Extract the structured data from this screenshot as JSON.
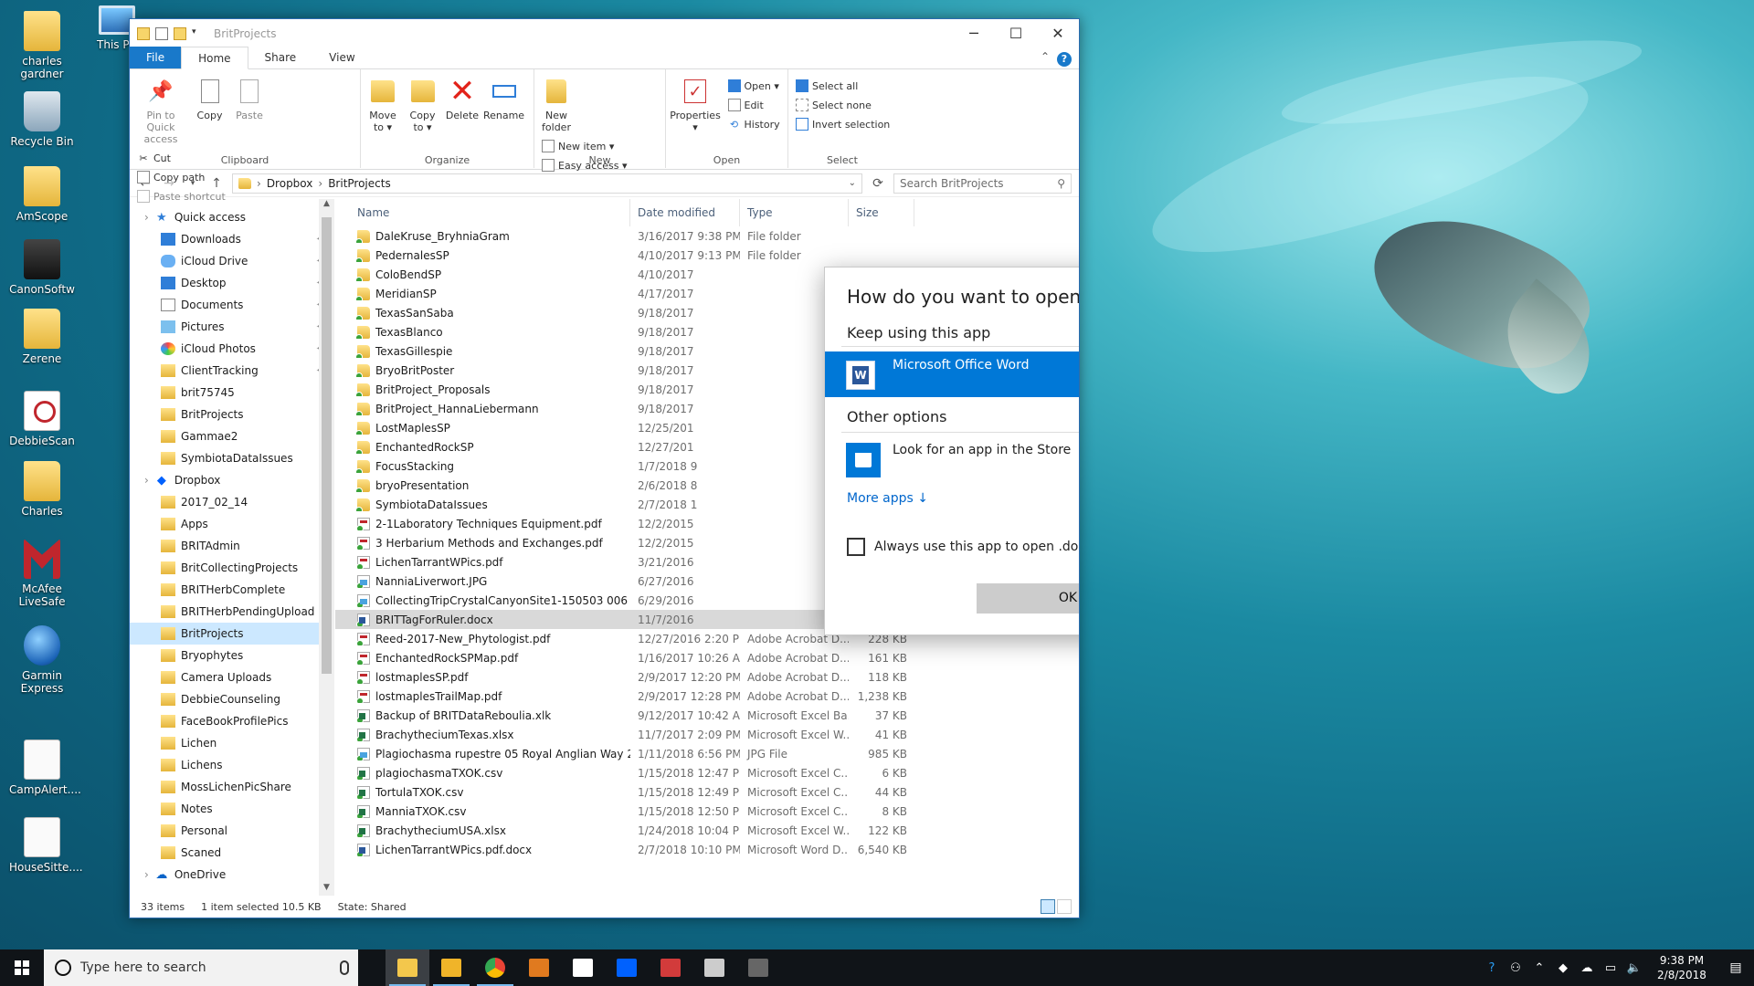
{
  "desktop": {
    "icons": [
      {
        "label": "charles\ngardner",
        "icon": "user-folder-icon"
      },
      {
        "label": "This PC",
        "icon": "this-pc-icon"
      },
      {
        "label": "Recycle Bin",
        "icon": "recycle-bin-icon"
      },
      {
        "label": "AmScope",
        "icon": "folder-icon"
      },
      {
        "label": "CanonSoftw",
        "icon": "camera-icon"
      },
      {
        "label": "Zerene",
        "icon": "folder-icon"
      },
      {
        "label": "DebbieScan",
        "icon": "pdf-icon"
      },
      {
        "label": "Charles",
        "icon": "folder-icon"
      },
      {
        "label": "McAfee\nLiveSafe",
        "icon": "mcafee-icon"
      },
      {
        "label": "Garmin\nExpress",
        "icon": "globe-icon"
      },
      {
        "label": "CampAlert....",
        "icon": "document-icon"
      },
      {
        "label": "HouseSitte....",
        "icon": "document-icon"
      }
    ]
  },
  "window": {
    "title": "BritProjects",
    "tabs": {
      "file": "File",
      "home": "Home",
      "share": "Share",
      "view": "View"
    },
    "help": "?",
    "ribbon": {
      "clipboard": {
        "pin": "Pin to Quick\naccess",
        "copy": "Copy",
        "paste": "Paste",
        "cut": "Cut",
        "copy_path": "Copy path",
        "paste_shortcut": "Paste shortcut",
        "label": "Clipboard"
      },
      "organize": {
        "move_to": "Move\nto ▾",
        "copy_to": "Copy\nto ▾",
        "delete": "Delete",
        "rename": "Rename",
        "label": "Organize"
      },
      "new": {
        "new_folder": "New\nfolder",
        "new_item": "New item ▾",
        "easy_access": "Easy access ▾",
        "label": "New"
      },
      "open": {
        "properties": "Properties\n▾",
        "open": "Open ▾",
        "edit": "Edit",
        "history": "History",
        "label": "Open"
      },
      "select": {
        "select_all": "Select all",
        "select_none": "Select none",
        "invert": "Invert selection",
        "label": "Select"
      }
    },
    "address": {
      "crumbs": [
        "Dropbox",
        "BritProjects"
      ],
      "search_placeholder": "Search BritProjects"
    },
    "nav": [
      {
        "label": "Quick access",
        "icon": "star-icon",
        "top": true
      },
      {
        "label": "Downloads",
        "icon": "download-icon",
        "pin": true
      },
      {
        "label": "iCloud Drive",
        "icon": "cloud-icon",
        "pin": true
      },
      {
        "label": "Desktop",
        "icon": "desktop-icon",
        "pin": true
      },
      {
        "label": "Documents",
        "icon": "documents-icon",
        "pin": true
      },
      {
        "label": "Pictures",
        "icon": "pictures-icon",
        "pin": true
      },
      {
        "label": "iCloud Photos",
        "icon": "photos-icon",
        "pin": true
      },
      {
        "label": "ClientTracking",
        "icon": "folder-icon",
        "pin": true
      },
      {
        "label": "brit75745",
        "icon": "folder-icon"
      },
      {
        "label": "BritProjects",
        "icon": "folder-icon"
      },
      {
        "label": "Gammae2",
        "icon": "folder-icon"
      },
      {
        "label": "SymbiotaDataIssues",
        "icon": "folder-icon"
      },
      {
        "label": "Dropbox",
        "icon": "dropbox-icon",
        "top": true
      },
      {
        "label": "2017_02_14",
        "icon": "folder-icon"
      },
      {
        "label": "Apps",
        "icon": "folder-icon"
      },
      {
        "label": "BRITAdmin",
        "icon": "folder-icon"
      },
      {
        "label": "BritCollectingProjects",
        "icon": "folder-icon"
      },
      {
        "label": "BRITHerbComplete",
        "icon": "folder-icon"
      },
      {
        "label": "BRITHerbPendingUpload",
        "icon": "folder-icon"
      },
      {
        "label": "BritProjects",
        "icon": "folder-icon",
        "selected": true
      },
      {
        "label": "Bryophytes",
        "icon": "folder-icon"
      },
      {
        "label": "Camera Uploads",
        "icon": "folder-icon"
      },
      {
        "label": "DebbieCounseling",
        "icon": "folder-icon"
      },
      {
        "label": "FaceBookProfilePics",
        "icon": "folder-icon"
      },
      {
        "label": "Lichen",
        "icon": "folder-icon"
      },
      {
        "label": "Lichens",
        "icon": "folder-icon"
      },
      {
        "label": "MossLichenPicShare",
        "icon": "folder-icon"
      },
      {
        "label": "Notes",
        "icon": "folder-icon"
      },
      {
        "label": "Personal",
        "icon": "folder-icon"
      },
      {
        "label": "Scaned",
        "icon": "folder-icon"
      },
      {
        "label": "OneDrive",
        "icon": "onedrive-icon",
        "top": true
      }
    ],
    "columns": {
      "name": "Name",
      "date": "Date modified",
      "type": "Type",
      "size": "Size"
    },
    "files": [
      {
        "name": "DaleKruse_BryhniaGram",
        "date": "3/16/2017 9:38 PM",
        "type": "File folder",
        "size": "",
        "kind": "folder"
      },
      {
        "name": "PedernalesSP",
        "date": "4/10/2017 9:13 PM",
        "type": "File folder",
        "size": "",
        "kind": "folder"
      },
      {
        "name": "ColoBendSP",
        "date": "4/10/2017",
        "type": "",
        "size": "",
        "kind": "folder"
      },
      {
        "name": "MeridianSP",
        "date": "4/17/2017",
        "type": "",
        "size": "",
        "kind": "folder"
      },
      {
        "name": "TexasSanSaba",
        "date": "9/18/2017",
        "type": "",
        "size": "",
        "kind": "folder"
      },
      {
        "name": "TexasBlanco",
        "date": "9/18/2017",
        "type": "",
        "size": "",
        "kind": "folder"
      },
      {
        "name": "TexasGillespie",
        "date": "9/18/2017",
        "type": "",
        "size": "",
        "kind": "folder"
      },
      {
        "name": "BryoBritPoster",
        "date": "9/18/2017",
        "type": "",
        "size": "",
        "kind": "folder"
      },
      {
        "name": "BritProject_Proposals",
        "date": "9/18/2017",
        "type": "",
        "size": "",
        "kind": "folder"
      },
      {
        "name": "BritProject_HannaLiebermann",
        "date": "9/18/2017",
        "type": "",
        "size": "",
        "kind": "folder"
      },
      {
        "name": "LostMaplesSP",
        "date": "12/25/201",
        "type": "",
        "size": "",
        "kind": "folder"
      },
      {
        "name": "EnchantedRockSP",
        "date": "12/27/201",
        "type": "",
        "size": "",
        "kind": "folder"
      },
      {
        "name": "FocusStacking",
        "date": "1/7/2018 9",
        "type": "",
        "size": "",
        "kind": "folder"
      },
      {
        "name": "bryoPresentation",
        "date": "2/6/2018 8",
        "type": "",
        "size": "",
        "kind": "folder"
      },
      {
        "name": "SymbiotaDataIssues",
        "date": "2/7/2018 1",
        "type": "",
        "size": "",
        "kind": "folder"
      },
      {
        "name": "2-1Laboratory Techniques Equipment.pdf",
        "date": "12/2/2015",
        "type": "",
        "size": "",
        "kind": "pdf"
      },
      {
        "name": "3 Herbarium Methods and Exchanges.pdf",
        "date": "12/2/2015",
        "type": "",
        "size": "",
        "kind": "pdf"
      },
      {
        "name": "LichenTarrantWPics.pdf",
        "date": "3/21/2016",
        "type": "",
        "size": "",
        "kind": "pdf"
      },
      {
        "name": "NanniaLiverwort.JPG",
        "date": "6/27/2016",
        "type": "",
        "size": "",
        "kind": "img"
      },
      {
        "name": "CollectingTripCrystalCanyonSite1-150503 006 - C...",
        "date": "6/29/2016",
        "type": "",
        "size": "",
        "kind": "img"
      },
      {
        "name": "BRITTagForRuler.docx",
        "date": "11/7/2016",
        "type": "",
        "size": "",
        "kind": "word",
        "selected": true
      },
      {
        "name": "Reed-2017-New_Phytologist.pdf",
        "date": "12/27/2016 2:20 PM",
        "type": "Adobe Acrobat D...",
        "size": "228 KB",
        "kind": "pdf"
      },
      {
        "name": "EnchantedRockSPMap.pdf",
        "date": "1/16/2017 10:26 AM",
        "type": "Adobe Acrobat D...",
        "size": "161 KB",
        "kind": "pdf"
      },
      {
        "name": "lostmaplesSP.pdf",
        "date": "2/9/2017 12:20 PM",
        "type": "Adobe Acrobat D...",
        "size": "118 KB",
        "kind": "pdf"
      },
      {
        "name": "lostmaplesTrailMap.pdf",
        "date": "2/9/2017 12:28 PM",
        "type": "Adobe Acrobat D...",
        "size": "1,238 KB",
        "kind": "pdf"
      },
      {
        "name": "Backup of BRITDataReboulia.xlk",
        "date": "9/12/2017 10:42 AM",
        "type": "Microsoft Excel Ba...",
        "size": "37 KB",
        "kind": "excel"
      },
      {
        "name": "BrachytheciumTexas.xlsx",
        "date": "11/7/2017 2:09 PM",
        "type": "Microsoft Excel W...",
        "size": "41 KB",
        "kind": "excel"
      },
      {
        "name": "Plagiochasma rupestre 05 Royal Anglian Way 25-...",
        "date": "1/11/2018 6:56 PM",
        "type": "JPG File",
        "size": "985 KB",
        "kind": "img"
      },
      {
        "name": "plagiochasmaTXOK.csv",
        "date": "1/15/2018 12:47 PM",
        "type": "Microsoft Excel C...",
        "size": "6 KB",
        "kind": "excel"
      },
      {
        "name": "TortulaTXOK.csv",
        "date": "1/15/2018 12:49 PM",
        "type": "Microsoft Excel C...",
        "size": "44 KB",
        "kind": "excel"
      },
      {
        "name": "ManniaTXOK.csv",
        "date": "1/15/2018 12:50 PM",
        "type": "Microsoft Excel C...",
        "size": "8 KB",
        "kind": "excel"
      },
      {
        "name": "BrachytheciumUSA.xlsx",
        "date": "1/24/2018 10:04 PM",
        "type": "Microsoft Excel W...",
        "size": "122 KB",
        "kind": "excel"
      },
      {
        "name": "LichenTarrantWPics.pdf.docx",
        "date": "2/7/2018 10:10 PM",
        "type": "Microsoft Word D...",
        "size": "6,540 KB",
        "kind": "word"
      }
    ],
    "status": {
      "count": "33 items",
      "selected": "1 item selected  10.5 KB",
      "state": "State: Shared"
    }
  },
  "dialog": {
    "question": "How do you want to open this file?",
    "keep": "Keep using this app",
    "app": "Microsoft Office Word",
    "app_icon_letter": "W",
    "other": "Other options",
    "store": "Look for an app in the Store",
    "more": "More apps  ↓",
    "always": "Always use this app to open .docx files",
    "ok": "OK"
  },
  "taskbar": {
    "search_placeholder": "Type here to search",
    "apps": [
      {
        "name": "file-explorer-icon",
        "color": "#f3c74c",
        "run": true,
        "active": true
      },
      {
        "name": "mail-icon",
        "color": "#f0b429",
        "run": true
      },
      {
        "name": "chrome-icon",
        "color": "#34a853",
        "run": true
      },
      {
        "name": "media-icon",
        "color": "#e07a1f",
        "run": false
      },
      {
        "name": "publisher-icon",
        "color": "#ffffff",
        "run": false
      },
      {
        "name": "dropbox-icon",
        "color": "#0061fe",
        "run": false
      },
      {
        "name": "snipping-icon",
        "color": "#d23b3b",
        "run": false
      },
      {
        "name": "calculator-icon",
        "color": "#cccccc",
        "run": false
      },
      {
        "name": "speed-icon",
        "color": "#666666",
        "run": false
      }
    ],
    "time": "9:38 PM",
    "date": "2/8/2018"
  }
}
